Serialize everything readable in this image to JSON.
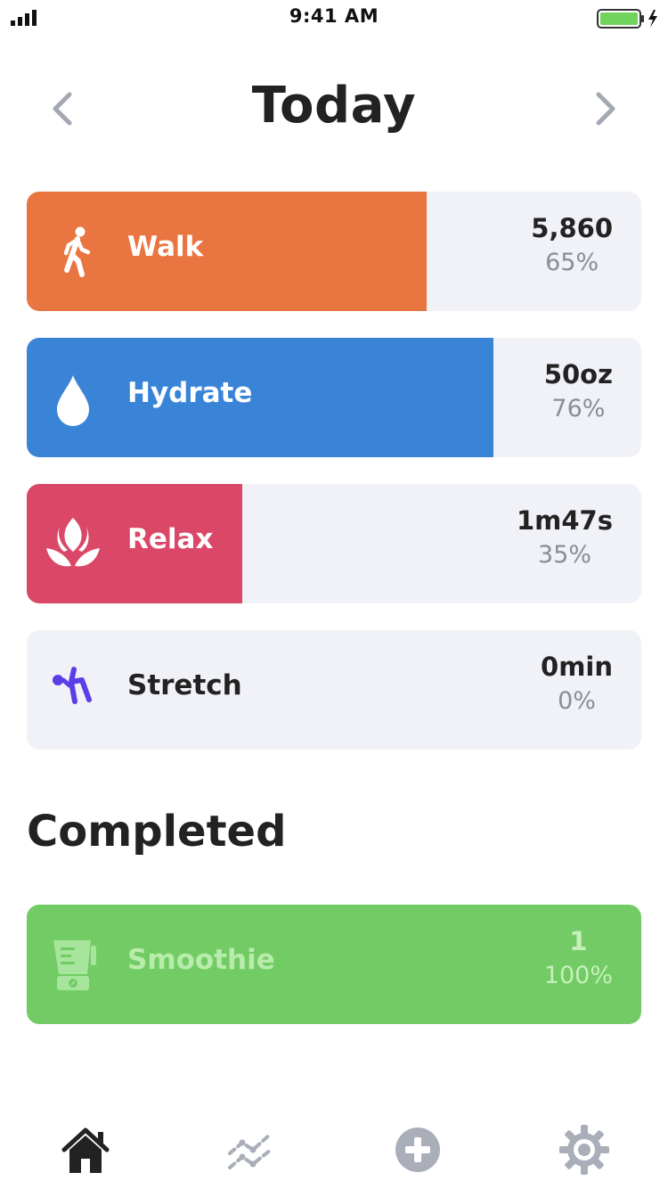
{
  "status_bar": {
    "time": "9:41 AM"
  },
  "header": {
    "title": "Today"
  },
  "habits": [
    {
      "name": "walk",
      "label": "Walk",
      "value": "5,860",
      "percent": "65%",
      "progress": 0.65,
      "color": "#e97541",
      "icon": "walking-person-icon"
    },
    {
      "name": "hydrate",
      "label": "Hydrate",
      "value": "50oz",
      "percent": "76%",
      "progress": 0.76,
      "color": "#3a84d8",
      "icon": "water-drop-icon"
    },
    {
      "name": "relax",
      "label": "Relax",
      "value": "1m47s",
      "percent": "35%",
      "progress": 0.35,
      "color": "#db4767",
      "icon": "lotus-icon"
    },
    {
      "name": "stretch",
      "label": "Stretch",
      "value": "0min",
      "percent": "0%",
      "progress": 0,
      "color": "#5b3ee6",
      "icon": "stretching-person-icon"
    }
  ],
  "completed": {
    "title": "Completed",
    "items": [
      {
        "name": "smoothie",
        "label": "Smoothie",
        "value": "1",
        "percent": "100%",
        "progress": 1,
        "color": "#72cb64",
        "icon": "blender-icon"
      }
    ]
  },
  "tab_bar": {
    "tabs": [
      {
        "name": "home",
        "icon": "home-icon",
        "active": true
      },
      {
        "name": "stats",
        "icon": "chart-icon",
        "active": false
      },
      {
        "name": "add",
        "icon": "plus-circle-icon",
        "active": false
      },
      {
        "name": "settings",
        "icon": "gear-icon",
        "active": false
      }
    ]
  },
  "colors": {
    "card_bg": "#f1f2f7",
    "text_dark": "#222222",
    "text_muted": "#8a8d96",
    "icon_inactive": "#a9aeb8"
  }
}
